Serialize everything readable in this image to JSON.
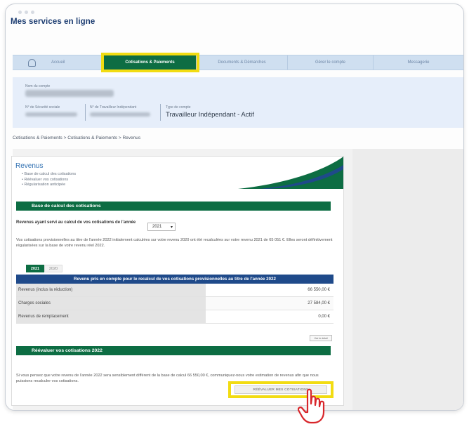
{
  "app": {
    "title": "Mes services en ligne"
  },
  "nav": {
    "tabs": [
      {
        "label": "Accueil"
      },
      {
        "label": "Cotisations & Paiements"
      },
      {
        "label": "Documents & Démarches"
      },
      {
        "label": "Gérer le compte"
      },
      {
        "label": "Messagerie"
      }
    ]
  },
  "account": {
    "name_label": "Nom du compte",
    "secu_label": "N° de Sécurité sociale",
    "ti_label": "N° de Travailleur Indépendant",
    "type_label": "Type de compte",
    "type_value": "Travailleur Indépendant - Actif"
  },
  "breadcrumb": "Cotisations & Paiements > Cotisations & Paiements > Revenus",
  "revenus": {
    "title": "Revenus",
    "links": [
      "Base de calcul des cotisations",
      "Réévaluer vos cotisations",
      "Régularisation anticipée"
    ]
  },
  "base": {
    "section_title": "Base de calcul des cotisations",
    "year_label": "Revenus ayant servi au calcul de vos cotisations de l'année",
    "year_value": "2021",
    "paragraph": "Vos cotisations provisionnelles au titre de l'année 2022 initialement calculées sur votre revenu 2020 ont été recalculées sur votre revenu 2021 de 65 051 €. Elles seront définitivement régularisées sur la base de votre revenu réel 2022.",
    "year_tabs": [
      "2021",
      "2020"
    ],
    "table": {
      "header": "Revenu pris en compte pour le recalcul de vos cotisations provisionnelles au titre de l'année 2022",
      "rows": [
        {
          "label": "Revenus (inclus la réduction)",
          "value": "66 550,00 €"
        },
        {
          "label": "Charges sociales",
          "value": "27 584,00 €"
        },
        {
          "label": "Revenus de remplacement",
          "value": "0,00 €"
        }
      ]
    },
    "small_button": "Voir le détail"
  },
  "reevaluer": {
    "section_title": "Réévaluer vos cotisations 2022",
    "paragraph": "Si vous pensez que votre revenu de l'année 2022 sera sensiblement différent de la base de calcul 66 550,00 €, communiquez-nous votre estimation de revenus afin que nous puissions recalculer vos cotisations.",
    "button_label": "RÉÉVALUER MES COTISATIONS"
  },
  "colors": {
    "brand_green": "#0d6d43",
    "brand_blue": "#1f4a8a",
    "highlight_yellow": "#f2dc12",
    "title_blue": "#1f3f73"
  }
}
